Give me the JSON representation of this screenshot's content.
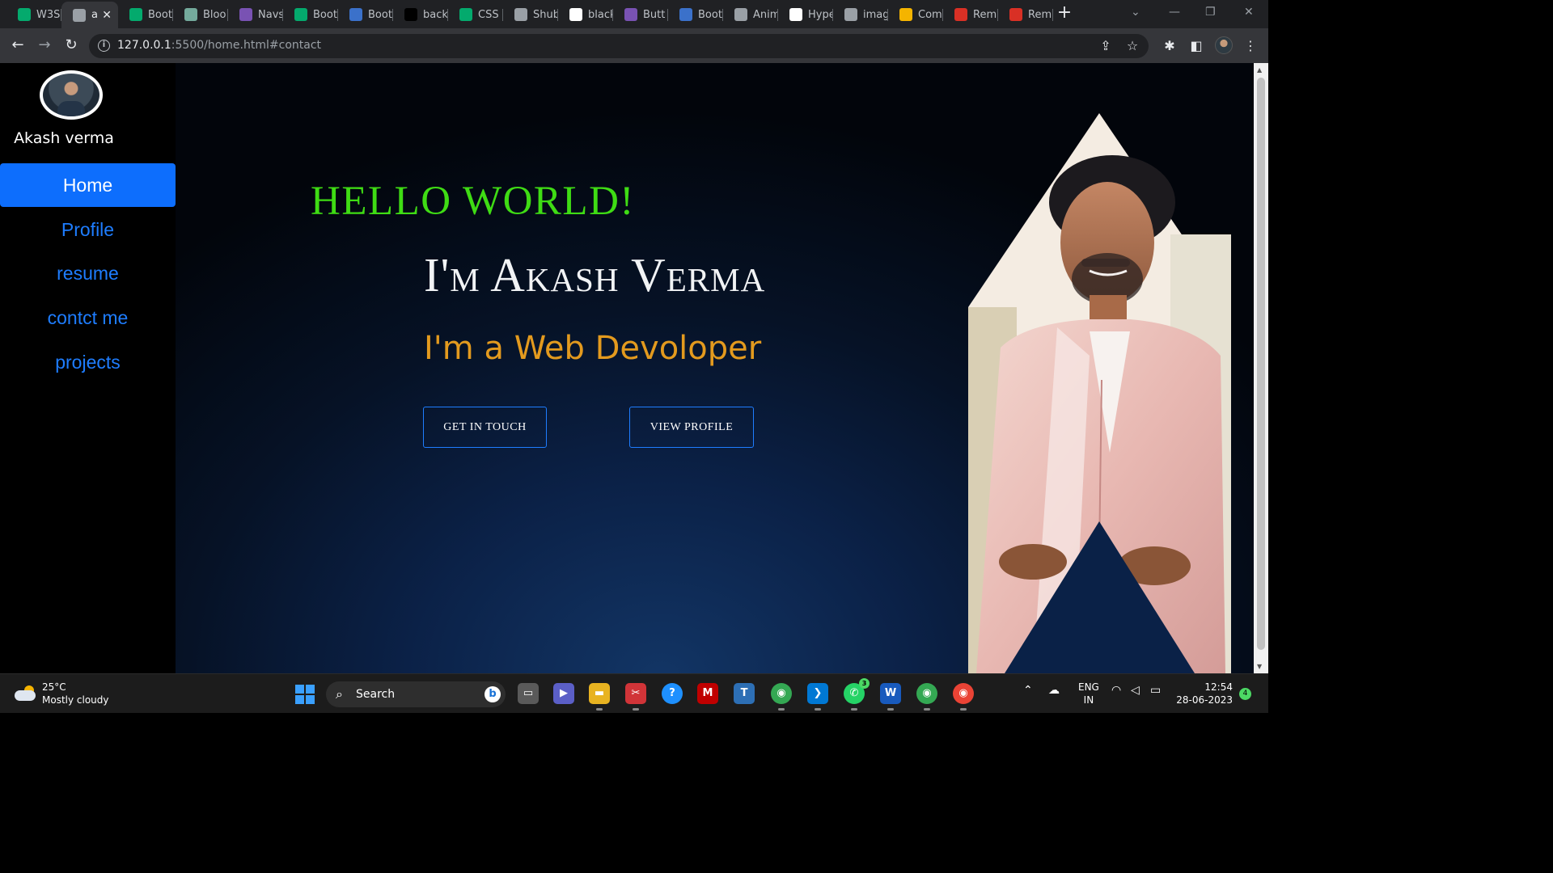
{
  "browser": {
    "tabs": [
      {
        "label": "W3S",
        "icon": "w3schools-icon",
        "color": "#04aa6d"
      },
      {
        "label": "a",
        "icon": "globe-icon",
        "color": "#9aa0a6",
        "active": true
      },
      {
        "label": "Boot",
        "icon": "w3schools-icon",
        "color": "#04aa6d"
      },
      {
        "label": "Bloo",
        "icon": "openai-icon",
        "color": "#74aa9c"
      },
      {
        "label": "Navs",
        "icon": "bootstrap-icon",
        "color": "#7952b3"
      },
      {
        "label": "Boot",
        "icon": "w3schools-icon",
        "color": "#04aa6d"
      },
      {
        "label": "Boot",
        "icon": "mdb-icon",
        "color": "#3b71ca"
      },
      {
        "label": "back",
        "icon": "m-icon",
        "color": "#000000"
      },
      {
        "label": "CSS",
        "icon": "w3schools-icon",
        "color": "#04aa6d"
      },
      {
        "label": "Shub",
        "icon": "globe-icon",
        "color": "#9aa0a6"
      },
      {
        "label": "black",
        "icon": "google-icon",
        "color": "#ffffff"
      },
      {
        "label": "Butt",
        "icon": "bootstrap-icon",
        "color": "#7952b3"
      },
      {
        "label": "Boot",
        "icon": "mdb-icon",
        "color": "#3b71ca"
      },
      {
        "label": "Anim",
        "icon": "globe-icon",
        "color": "#9aa0a6"
      },
      {
        "label": "Hype",
        "icon": "codepen-icon",
        "color": "#ffffff"
      },
      {
        "label": "imag",
        "icon": "globe-icon",
        "color": "#9aa0a6"
      },
      {
        "label": "Com",
        "icon": "chart-icon",
        "color": "#f5b400"
      },
      {
        "label": "Rem",
        "icon": "remove-bg-icon",
        "color": "#d93025"
      },
      {
        "label": "Rem",
        "icon": "remove-bg-icon",
        "color": "#d93025"
      }
    ],
    "address": {
      "host": "127.0.0.1",
      "rest": ":5500/home.html#contact"
    }
  },
  "sidebar": {
    "name": "Akash verma",
    "nav": [
      {
        "label": "Home",
        "active": true
      },
      {
        "label": "Profile"
      },
      {
        "label": "resume"
      },
      {
        "label": "contct me"
      },
      {
        "label": "projects"
      }
    ]
  },
  "hero": {
    "greeting": "HELLO WORLD!",
    "headline": "I'm Akash Verma",
    "role": "I'm a Web Devoloper",
    "btn_touch": "GET IN TOUCH",
    "btn_profile": "VIEW PROFILE"
  },
  "taskbar": {
    "temp": "25°C",
    "condition": "Mostly cloudy",
    "search_label": "Search",
    "lang1": "ENG",
    "lang2": "IN",
    "time": "12:54",
    "date": "28-06-2023",
    "notif_count": "4",
    "whatsapp_badge": "3"
  },
  "colors": {
    "accent": "#0d6efd",
    "hello": "#3fdc14",
    "role": "#e39a1e"
  }
}
